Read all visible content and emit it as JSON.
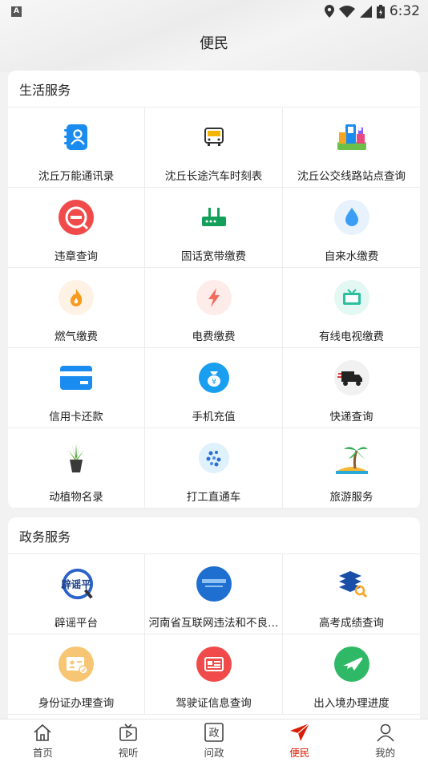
{
  "status_bar": {
    "notification": "A",
    "time": "6:32"
  },
  "page_title": "便民",
  "life_services": {
    "title": "生活服务",
    "items": [
      {
        "label": "沈丘万能通讯录",
        "icon": "contacts-book-icon"
      },
      {
        "label": "沈丘长途汽车时刻表",
        "icon": "bus-icon"
      },
      {
        "label": "沈丘公交线路站点查询",
        "icon": "city-map-icon"
      },
      {
        "label": "违章查询",
        "icon": "violation-icon"
      },
      {
        "label": "固话宽带缴费",
        "icon": "router-icon"
      },
      {
        "label": "自来水缴费",
        "icon": "water-drop-icon"
      },
      {
        "label": "燃气缴费",
        "icon": "flame-icon"
      },
      {
        "label": "电费缴费",
        "icon": "lightning-icon"
      },
      {
        "label": "有线电视缴费",
        "icon": "tv-icon"
      },
      {
        "label": "信用卡还款",
        "icon": "credit-card-icon"
      },
      {
        "label": "手机充值",
        "icon": "money-bag-icon"
      },
      {
        "label": "快递查询",
        "icon": "delivery-truck-icon"
      },
      {
        "label": "动植物名录",
        "icon": "potted-plant-icon"
      },
      {
        "label": "打工直通车",
        "icon": "dots-circle-icon"
      },
      {
        "label": "旅游服务",
        "icon": "palm-island-icon"
      }
    ]
  },
  "gov_services": {
    "title": "政务服务",
    "items": [
      {
        "label": "辟谣平台",
        "icon": "rumor-logo-icon",
        "logo_text": "辟谣平"
      },
      {
        "label": "河南省互联网违法和不良…",
        "icon": "report-logo-icon"
      },
      {
        "label": "高考成绩查询",
        "icon": "books-search-icon"
      },
      {
        "label": "身份证办理查询",
        "icon": "id-card-icon"
      },
      {
        "label": "驾驶证信息查询",
        "icon": "driver-license-icon"
      },
      {
        "label": "出入境办理进度",
        "icon": "plane-icon"
      }
    ]
  },
  "bottom_nav": [
    {
      "label": "首页",
      "icon": "home-icon"
    },
    {
      "label": "视听",
      "icon": "video-icon"
    },
    {
      "label": "问政",
      "icon": "gov-icon",
      "glyph": "政"
    },
    {
      "label": "便民",
      "icon": "send-arrow-icon",
      "active": true
    },
    {
      "label": "我的",
      "icon": "user-icon"
    }
  ],
  "colors": {
    "accent": "#d81e06",
    "blue": "#1a8cf0",
    "red": "#f04a4a",
    "green": "#2fb865"
  }
}
